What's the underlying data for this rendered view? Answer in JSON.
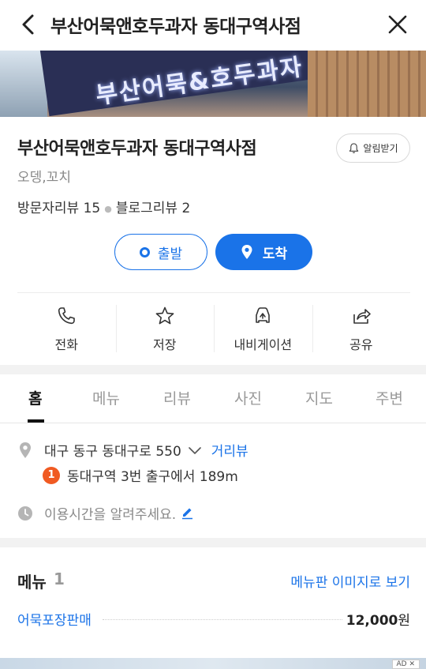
{
  "header": {
    "title": "부산어묵앤호두과자 동대구역사점"
  },
  "hero": {
    "sign_text": "부산어묵&호두과자"
  },
  "place": {
    "name": "부산어묵앤호두과자 동대구역사점",
    "alarm_label": "알림받기",
    "category": "오뎅,꼬치",
    "visitor_reviews": "방문자리뷰 15",
    "blog_reviews": "블로그리뷰 2"
  },
  "route": {
    "depart_label": "출발",
    "arrive_label": "도착"
  },
  "actions": [
    {
      "label": "전화",
      "icon": "phone-icon"
    },
    {
      "label": "저장",
      "icon": "star-icon"
    },
    {
      "label": "내비게이션",
      "icon": "navigation-car-icon"
    },
    {
      "label": "공유",
      "icon": "share-icon"
    }
  ],
  "tabs": [
    "홈",
    "메뉴",
    "리뷰",
    "사진",
    "지도",
    "주변"
  ],
  "info": {
    "address": "대구 동구 동대구로 550",
    "road_view": "거리뷰",
    "subway_line": "1",
    "subway_text": "동대구역 3번 출구에서 189m",
    "hours_prompt": "이용시간을 알려주세요."
  },
  "menu": {
    "title": "메뉴",
    "count": "1",
    "view_board": "메뉴판 이미지로 보기",
    "items": [
      {
        "name": "어묵포장판매",
        "price": "12,000",
        "unit": "원"
      }
    ]
  },
  "ad": {
    "badge": "AD ✕"
  },
  "colors": {
    "accent": "#1a73e8",
    "subway_line1": "#f05a22"
  }
}
